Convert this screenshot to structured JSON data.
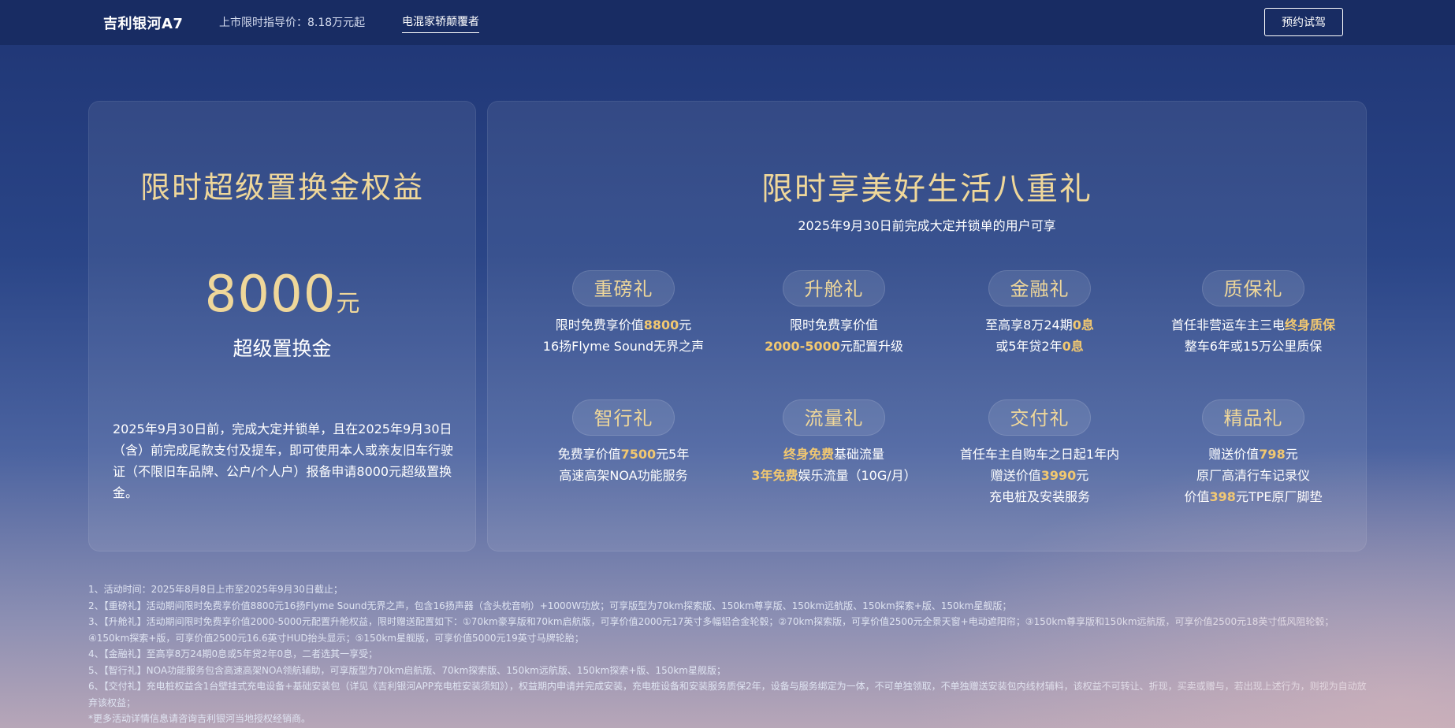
{
  "header": {
    "brand": "吉利银河A7",
    "price_text": "上市限时指导价：8.18万元起",
    "slogan": "电混家轿颠覆者",
    "book_button": "预约试驾"
  },
  "left_panel": {
    "title": "限时超级置换金权益",
    "amount": "8000",
    "amount_unit": "元",
    "amount_label": "超级置换金",
    "description": "2025年9月30日前，完成大定并锁单，且在2025年9月30日（含）前完成尾款支付及提车，即可使用本人或亲友旧车行驶证（不限旧车品牌、公户/个人户）报备申请8000元超级置换金。"
  },
  "right_panel": {
    "title": "限时享美好生活八重礼",
    "subtitle": "2025年9月30日前完成大定并锁单的用户可享",
    "gifts": [
      {
        "name": "重磅礼",
        "line1_a": "限时免费享价值",
        "line1_b": "8800",
        "line1_c": "元",
        "line2_a": "16扬Flyme Sound无界之声",
        "line2_b": "",
        "line2_c": ""
      },
      {
        "name": "升舱礼",
        "line1_a": "限时免费享价值",
        "line1_b": "",
        "line1_c": "",
        "line2_a": "",
        "line2_b": "2000-5000",
        "line2_c": "元配置升级"
      },
      {
        "name": "金融礼",
        "line1_a": "至高享8万24期",
        "line1_b": "0息",
        "line1_c": "",
        "line2_a": "或5年贷2年",
        "line2_b": "0息",
        "line2_c": ""
      },
      {
        "name": "质保礼",
        "line1_a": "首任非营运车主三电",
        "line1_b": "终身质保",
        "line1_c": "",
        "line2_a": "整车6年或15万公里质保",
        "line2_b": "",
        "line2_c": ""
      },
      {
        "name": "智行礼",
        "line1_a": "免费享价值",
        "line1_b": "7500",
        "line1_c": "元5年",
        "line2_a": "高速高架NOA功能服务",
        "line2_b": "",
        "line2_c": ""
      },
      {
        "name": "流量礼",
        "line1_a": "",
        "line1_b": "终身免费",
        "line1_c": "基础流量",
        "line2_a": "",
        "line2_b": "3年免费",
        "line2_c": "娱乐流量（10G/月）"
      },
      {
        "name": "交付礼",
        "line1_a": "首任车主自购车之日起1年内",
        "line1_b": "",
        "line1_c": "",
        "line2_a": "赠送价值",
        "line2_b": "3990",
        "line2_c": "元",
        "line3_a": "充电桩及安装服务",
        "line3_b": "",
        "line3_c": ""
      },
      {
        "name": "精品礼",
        "line1_a": "赠送价值",
        "line1_b": "798",
        "line1_c": "元",
        "line2_a": "原厂高清行车记录仪",
        "line2_b": "",
        "line2_c": "",
        "line3_a": "价值",
        "line3_b": "398",
        "line3_c": "元TPE原厂脚垫"
      }
    ]
  },
  "notes": [
    "1、活动时间：2025年8月8日上市至2025年9月30日截止；",
    "2、【重磅礼】活动期间限时免费享价值8800元16扬Flyme Sound无界之声，包含16扬声器（含头枕音响）+1000W功放；可享版型为70km探索版、150km尊享版、150km远航版、150km探索+版、150km星舰版；",
    "3、【升舱礼】活动期间限时免费享价值2000-5000元配置升舱权益，限时赠送配置如下：①70km豪享版和70km启航版，可享价值2000元17英寸多幅铝合金轮毂；②70km探索版，可享价值2500元全景天窗+电动遮阳帘；③150km尊享版和150km远航版，可享价值2500元18英寸低风阻轮毂；④150km探索+版，可享价值2500元16.6英寸HUD抬头显示；⑤150km星舰版，可享价值5000元19英寸马牌轮胎；",
    "4、【金融礼】至高享8万24期0息或5年贷2年0息，二者选其一享受；",
    "5、【智行礼】NOA功能服务包含高速高架NOA领航辅助，可享版型为70km启航版、70km探索版、150km远航版、150km探索+版、150km星舰版；",
    "6、【交付礼】充电桩权益含1台壁挂式充电设备+基础安装包（详见《吉利银河APP充电桩安装须知》），权益期内申请并完成安装，充电桩设备和安装服务质保2年，设备与服务绑定为一体，不可单独领取，不单独赠送安装包内线材辅料，该权益不可转让、折现，买卖或赠与，若出现上述行为，则视为自动放弃该权益；",
    "*更多活动详情信息请咨询吉利银河当地授权经销商。"
  ],
  "colors": {
    "gold": "#efd79a",
    "highlight": "#f2c870",
    "header_bg": "#182c63"
  }
}
